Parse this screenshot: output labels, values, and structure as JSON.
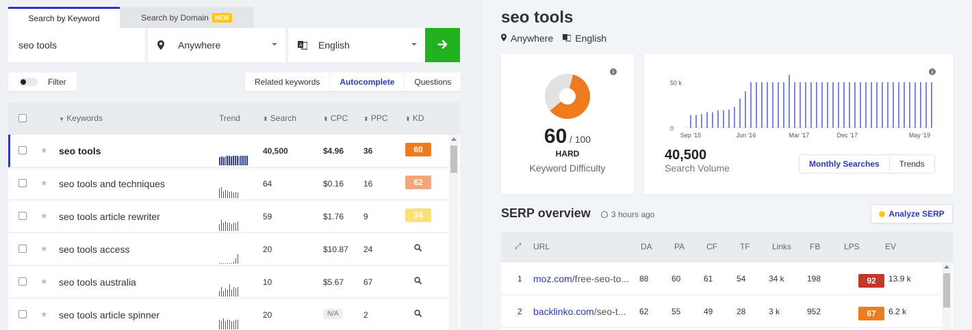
{
  "tabs": {
    "keyword": "Search by Keyword",
    "domain": "Search by Domain",
    "new_badge": "NEW"
  },
  "search": {
    "value": "seo tools",
    "location": "Anywhere",
    "language": "English",
    "go_icon": "arrow-right-icon"
  },
  "filter": {
    "label": "Filter"
  },
  "modes": {
    "related": "Related keywords",
    "autocomplete": "Autocomplete",
    "questions": "Questions"
  },
  "columns": {
    "keywords": "Keywords",
    "trend": "Trend",
    "search": "Search",
    "cpc": "CPC",
    "ppc": "PPC",
    "kd": "KD"
  },
  "rows": [
    {
      "keyword": "seo tools",
      "search": "40,500",
      "cpc": "$4.96",
      "ppc": "36",
      "kd": "60",
      "kd_color": "#f07b1f",
      "trend": [
        12,
        13,
        12,
        13,
        14,
        14,
        13,
        14,
        14,
        14,
        13,
        14,
        14,
        14,
        14
      ]
    },
    {
      "keyword": "seo tools and techniques",
      "search": "64",
      "cpc": "$0.16",
      "ppc": "16",
      "kd": "62",
      "kd_color": "#f2a57a",
      "trend": [
        14,
        16,
        10,
        12,
        11,
        9,
        10,
        8,
        9,
        8
      ]
    },
    {
      "keyword": "seo tools article rewriter",
      "search": "59",
      "cpc": "$1.76",
      "ppc": "9",
      "kd": "34",
      "kd_color": "#fae17a",
      "trend": [
        10,
        16,
        12,
        14,
        12,
        12,
        10,
        12,
        12,
        14
      ]
    },
    {
      "keyword": "seo tools access",
      "search": "20",
      "cpc": "$10.87",
      "ppc": "24",
      "kd": "",
      "kd_color": "",
      "trend": [
        1,
        1,
        1,
        1,
        1,
        1,
        1,
        3,
        8,
        14
      ]
    },
    {
      "keyword": "seo tools australia",
      "search": "10",
      "cpc": "$5.67",
      "ppc": "67",
      "kd": "",
      "kd_color": "",
      "trend": [
        8,
        14,
        8,
        12,
        10,
        18,
        10,
        14,
        12,
        14
      ]
    },
    {
      "keyword": "seo tools article spinner",
      "search": "20",
      "cpc": "N/A",
      "ppc": "2",
      "kd": "",
      "kd_color": "",
      "trend": [
        14,
        12,
        16,
        12,
        14,
        14,
        12,
        12,
        14,
        14
      ]
    }
  ],
  "detail": {
    "title": "seo tools",
    "location": "Anywhere",
    "language": "English",
    "kd_value": "60",
    "kd_max": "/ 100",
    "kd_level": "HARD",
    "kd_caption": "Keyword Difficulty",
    "kd_fraction": 0.6,
    "kd_color": "#f07b1f",
    "volume": "40,500",
    "volume_caption": "Search Volume",
    "vol_modes": {
      "monthly": "Monthly Searches",
      "trends": "Trends"
    }
  },
  "chart_data": {
    "type": "bar",
    "y_ticks": [
      "50 k",
      "0"
    ],
    "x_ticks": [
      "Sep '15",
      "Jun '16",
      "Mar '17",
      "Dec '17",
      "May '19"
    ],
    "ylim": [
      0,
      60000
    ],
    "values": [
      14000,
      14000,
      15000,
      17000,
      17000,
      19000,
      19000,
      20000,
      23000,
      32000,
      40000,
      50000,
      50000,
      50000,
      50000,
      50000,
      50000,
      50000,
      58000,
      50000,
      50000,
      50000,
      50000,
      50000,
      50000,
      50000,
      50000,
      50000,
      50000,
      50000,
      50000,
      50000,
      50000,
      50000,
      50000,
      50000,
      50000,
      50000,
      50000,
      50000,
      50000,
      50000,
      50000,
      50000,
      50000
    ]
  },
  "serp": {
    "heading": "SERP overview",
    "ago": "3 hours ago",
    "analyze": "Analyze SERP",
    "columns": {
      "url": "URL",
      "da": "DA",
      "pa": "PA",
      "cf": "CF",
      "tf": "TF",
      "links": "Links",
      "fb": "FB",
      "lps": "LPS",
      "ev": "EV"
    },
    "rows": [
      {
        "rank": "1",
        "domain": "moz.com",
        "path": "/free-seo-to...",
        "da": "88",
        "pa": "60",
        "cf": "61",
        "tf": "54",
        "links": "34 k",
        "fb": "198",
        "lps": "92",
        "lps_color": "#c0392b",
        "ev": "13.9 k"
      },
      {
        "rank": "2",
        "domain": "backlinko.com",
        "path": "/seo-t...",
        "da": "62",
        "pa": "55",
        "cf": "49",
        "tf": "28",
        "links": "3 k",
        "fb": "952",
        "lps": "67",
        "lps_color": "#f07b1f",
        "ev": "6.2 k"
      }
    ]
  }
}
